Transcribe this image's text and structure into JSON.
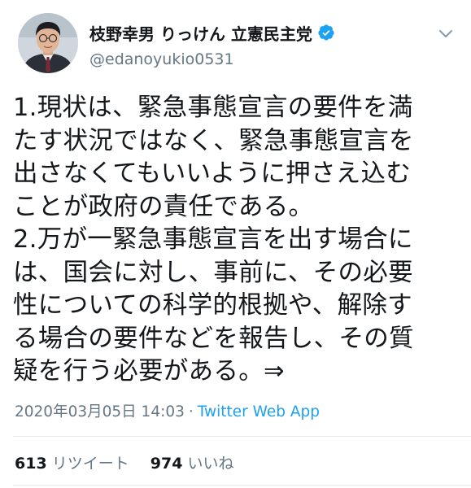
{
  "author": {
    "display_name": "枝野幸男 りっけん 立憲民主党",
    "handle": "@edanoyukio0531",
    "verified": true
  },
  "icons": {
    "avatar": "profile-photo",
    "verified": "verified-badge-icon",
    "caret": "chevron-down-icon"
  },
  "tweet": {
    "lines": [
      "1.現状は、緊急事態宣言の要件を満",
      "たす状況ではなく、緊急事態宣言を",
      "出さなくてもいいように押さえ込む",
      "ことが政府の責任である。",
      "2.万が一緊急事態宣言を出す場合に",
      "は、国会に対し、事前に、その必要",
      "性についての科学的根拠や、解除す",
      "る場合の要件などを報告し、その質",
      "疑を行う必要がある。⇒"
    ],
    "timestamp": "2020年03月05日 14:03",
    "separator": "·",
    "source": "Twitter Web App"
  },
  "stats": {
    "retweets_count": "613",
    "retweets_label": "リツイート",
    "likes_count": "974",
    "likes_label": "いいね"
  },
  "colors": {
    "text": "#14171a",
    "secondary": "#657786",
    "accent": "#1da1f2",
    "divider": "#e6ecf0"
  }
}
